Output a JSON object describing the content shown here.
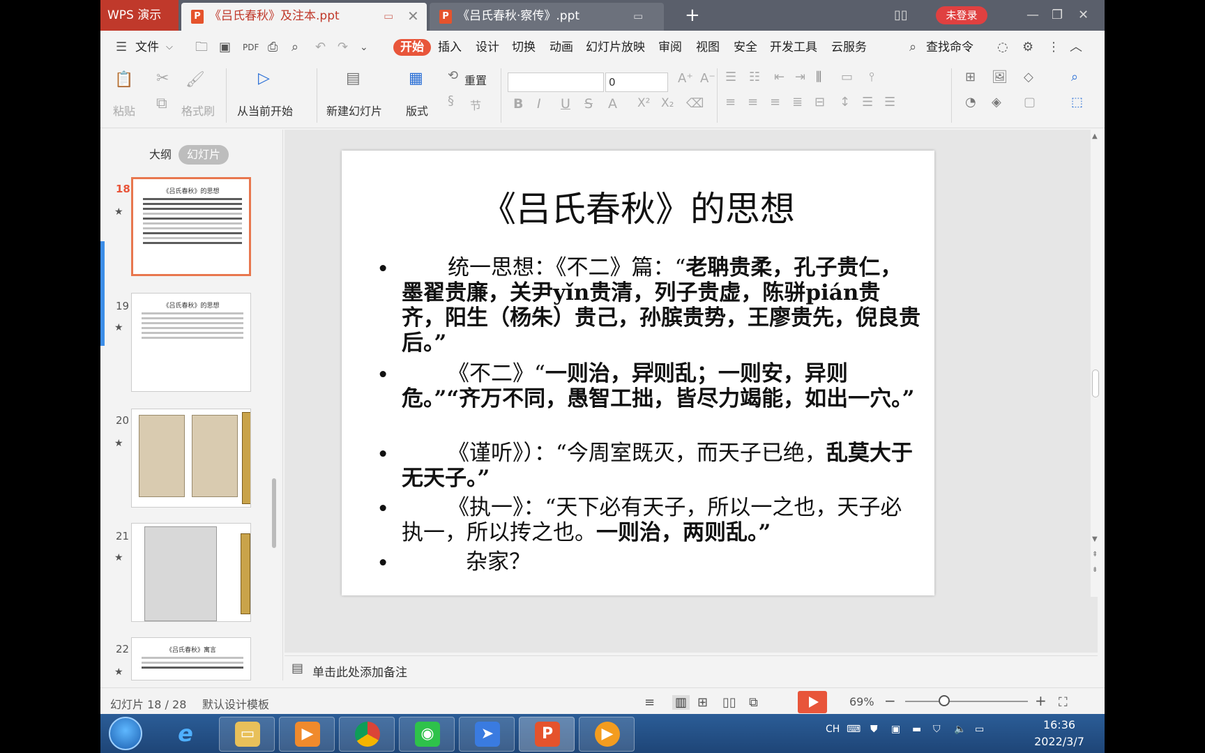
{
  "window": {
    "app_name": "WPS 演示",
    "tabs": [
      {
        "label": "《吕氏春秋》及注本.ppt",
        "active": true
      },
      {
        "label": "《吕氏春秋·察传》.ppt",
        "active": false
      }
    ],
    "login_label": "未登录",
    "accent_color": "#e8553a"
  },
  "menu": {
    "file_label": "文件",
    "items": [
      "开始",
      "插入",
      "设计",
      "切换",
      "动画",
      "幻灯片放映",
      "审阅",
      "视图",
      "安全",
      "开发工具",
      "云服务"
    ],
    "active_item": "开始",
    "search_label": "查找命令"
  },
  "ribbon": {
    "paste": "粘贴",
    "format_painter": "格式刷",
    "from_current": "从当前开始",
    "new_slide": "新建幻灯片",
    "layout": "版式",
    "reset": "重置",
    "section": "节",
    "font_name": "",
    "font_size": "0"
  },
  "left_panel": {
    "tab_outline": "大纲",
    "tab_slides": "幻灯片",
    "thumbnails": [
      {
        "num": "18",
        "title": "《吕氏春秋》的思想",
        "selected": true
      },
      {
        "num": "19",
        "title": "《吕氏春秋》的思想",
        "selected": false
      },
      {
        "num": "20",
        "title": "",
        "selected": false
      },
      {
        "num": "21",
        "title": "",
        "selected": false
      },
      {
        "num": "22",
        "title": "《吕氏春秋》寓言",
        "selected": false
      }
    ]
  },
  "slide": {
    "title": "《吕氏春秋》的思想",
    "bullets": [
      {
        "first": "统一思想：《不二》篇：“",
        "bold": "老聃贵柔，孔子贵仁，墨翟贵廉，关尹yǐn贵清，列子贵虚，陈骈pián贵齐，阳生（杨朱）贵己，孙膑贵势，王廖贵先，倪良贵后。”"
      },
      {
        "first": "《不二》“",
        "bold": "一则治，异则乱；一则安，异则危。”“齐万不同，愚智工拙，皆尽力竭能，如出一穴。”"
      },
      {
        "first": "《谨听》）：“今周室既灭，而天子已绝，",
        "bold": "乱莫大于无天子。”"
      },
      {
        "first": "《执一》：“天下必有天子，所以一之也，天子必执一，所以抟之也。",
        "bold": "一则治，两则乱。”"
      },
      {
        "first": "杂家？",
        "bold": ""
      }
    ]
  },
  "notes": {
    "placeholder": "单击此处添加备注"
  },
  "status": {
    "slide_counter": "幻灯片 18 / 28",
    "template": "默认设计模板",
    "zoom": "69%",
    "zoom_fraction": 0.69
  },
  "taskbar": {
    "apps": [
      "ie-icon",
      "explorer-icon",
      "media-player-icon",
      "chrome-icon",
      "wechat-icon",
      "feishu-icon",
      "wps-presentation-icon",
      "video-icon"
    ],
    "ime": "CH",
    "time": "16:36",
    "date": "2022/3/7"
  }
}
